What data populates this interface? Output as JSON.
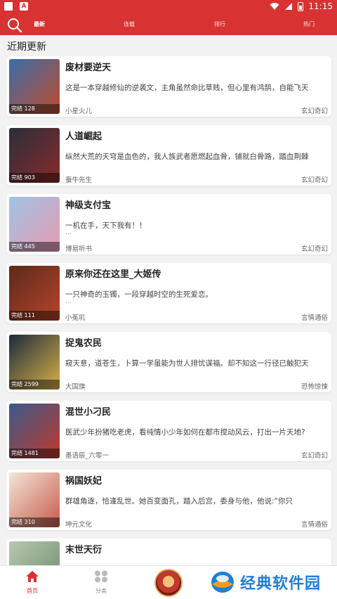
{
  "status_bar": {
    "time": "11:15",
    "notification_letter": "A"
  },
  "header": {
    "tabs": [
      {
        "label": "最新",
        "active": true
      },
      {
        "label": "连载",
        "active": false
      },
      {
        "label": "排行",
        "active": false
      },
      {
        "label": "热门",
        "active": false
      }
    ]
  },
  "section_title": "近期更新",
  "books": [
    {
      "title": "废材要逆天",
      "desc": "这是一本穿越修仙的逆袭文，主角虽然命比草贱，但心里有鸿鹄，自能飞天",
      "desc_extra": "",
      "author": "小星火儿",
      "genre": "玄幻奇幻",
      "badge": "完结 128",
      "colors": [
        "#3a6ea8",
        "#c04a2a"
      ]
    },
    {
      "title": "人道崛起",
      "desc": "纵然大荒的天穹是血色的，我人族武者愿燃起血骨，铺就白骨路，踏血荆棘",
      "desc_extra": "",
      "author": "蚕牛先生",
      "genre": "玄幻奇幻",
      "badge": "完结 903",
      "colors": [
        "#2a2f3a",
        "#8a2a2a"
      ]
    },
    {
      "title": "神级支付宝",
      "desc": "一机在手，天下我有！！",
      "desc_extra": "...",
      "author": "博易听书",
      "genre": "玄幻奇幻",
      "badge": "完结 445",
      "colors": [
        "#9fc3e6",
        "#e89ab0"
      ]
    },
    {
      "title": "原来你还在这里_大姬传",
      "desc": " 一只神奇的玉镯，一段穿越时空的生死爱恋。",
      "desc_extra": "...",
      "author": "小菟叽",
      "genre": "言情通俗",
      "badge": "完结 111",
      "colors": [
        "#5a2a1a",
        "#b8442a"
      ]
    },
    {
      "title": "捉鬼农民",
      "desc": "窥天意，道苍生，卜算一学虽能为世人排忧谋福。却不知这一行径已触犯天",
      "desc_extra": "",
      "author": "大国旗",
      "genre": "恐怖惊悚",
      "badge": "完结 2599",
      "colors": [
        "#1e2a3a",
        "#d8b24a"
      ]
    },
    {
      "title": "混世小刁民",
      "desc": "医武少年扮猪吃老虎，看纯情小少年如何在都市搅动风云，打出一片天地?",
      "desc_extra": "",
      "author": "墨语辰_六零一",
      "genre": "玄幻奇幻",
      "badge": "完结 1481",
      "colors": [
        "#3a5a8a",
        "#c0392b"
      ]
    },
    {
      "title": "祸国妖妃",
      "desc": "群雄角逐，恰逢乱世。她百变面孔，踏入后宫，委身与他，他说:“你只",
      "desc_extra": "",
      "author": "坤元文化",
      "genre": "言情通俗",
      "badge": "完结 310",
      "colors": [
        "#f2e6d8",
        "#c85a4a"
      ]
    },
    {
      "title": "末世天衍",
      "desc": "",
      "desc_extra": "",
      "author": "",
      "genre": "",
      "badge": "",
      "colors": [
        "#b8c8b0",
        "#6a8a6a"
      ]
    }
  ],
  "bottom_nav": {
    "home_label": "首页",
    "category_label": "分类",
    "accent_color": "#d83232"
  },
  "watermark_text": "经典软件园"
}
